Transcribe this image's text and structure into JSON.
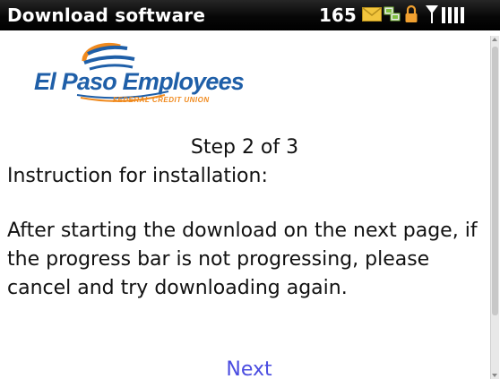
{
  "titlebar": {
    "title": "Download software",
    "message_count": "165",
    "icons": [
      "envelope-icon",
      "network-icon",
      "lock-icon",
      "antenna-icon",
      "signal-bars-icon"
    ]
  },
  "logo": {
    "name": "El Paso Employees",
    "subtitle": "FEDERAL CREDIT UNION"
  },
  "content": {
    "step": "Step 2 of 3",
    "instruction_title": "Instruction for installation:",
    "instruction_body": "After starting the download on the next page, if the progress bar is not progressing, please cancel and try downloading again.",
    "next_link": "Next"
  },
  "colors": {
    "titlebar_bg": "#000000",
    "link": "#4a4ce0",
    "brand_blue": "#1f5fa8",
    "brand_orange": "#f08a1e"
  }
}
